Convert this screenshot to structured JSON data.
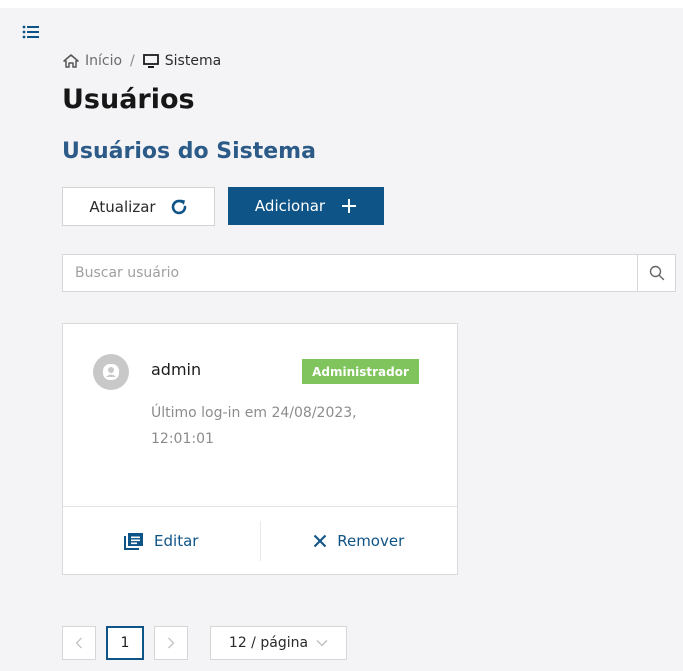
{
  "breadcrumb": {
    "home_label": "Início",
    "separator": "/",
    "current_label": "Sistema"
  },
  "page": {
    "title": "Usuários",
    "subtitle": "Usuários do Sistema"
  },
  "toolbar": {
    "refresh_label": "Atualizar",
    "add_label": "Adicionar"
  },
  "search": {
    "placeholder": "Buscar usuário",
    "value": ""
  },
  "users": [
    {
      "name": "admin",
      "role": "Administrador",
      "last_login_line1": "Último log-in em 24/08/2023,",
      "last_login_line2": "12:01:01",
      "edit_label": "Editar",
      "remove_label": "Remover"
    }
  ],
  "pagination": {
    "current_page": "1",
    "page_size_label": "12 / página"
  },
  "colors": {
    "primary": "#0f5486",
    "subtitle": "#2c5b88",
    "badge": "#7fc45c",
    "background": "#f4f4f6"
  },
  "icons": {
    "menu": "list-icon",
    "home": "home-icon",
    "monitor": "monitor-icon",
    "refresh": "refresh-icon",
    "add": "plus-icon",
    "search": "search-icon",
    "avatar": "user-icon",
    "edit": "edit-icon",
    "remove": "close-icon"
  }
}
